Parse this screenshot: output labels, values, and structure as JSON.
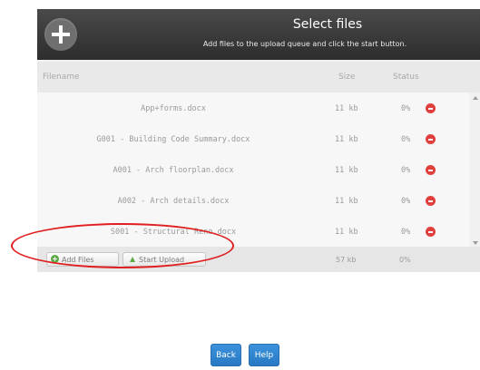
{
  "header": {
    "title": "Select files",
    "subtitle": "Add files to the upload queue and click the start button."
  },
  "columns": {
    "filename": "Filename",
    "size": "Size",
    "status": "Status"
  },
  "files": [
    {
      "name": "App+forms.docx",
      "size": "11 kb",
      "status": "0%"
    },
    {
      "name": "G001 - Building Code Summary.docx",
      "size": "11 kb",
      "status": "0%"
    },
    {
      "name": "A001 - Arch floorplan.docx",
      "size": "11 kb",
      "status": "0%"
    },
    {
      "name": "A002 - Arch details.docx",
      "size": "11 kb",
      "status": "0%"
    },
    {
      "name": "S001 - Structural Reno.docx",
      "size": "11 kb",
      "status": "0%"
    }
  ],
  "footer": {
    "add_files_label": "Add Files",
    "start_upload_label": "Start Upload",
    "total_size": "57 kb",
    "total_status": "0%"
  },
  "nav": {
    "back_label": "Back",
    "help_label": "Help"
  },
  "colors": {
    "header_bg": "#333333",
    "remove_icon": "#e0403c",
    "add_icon": "#5aab45",
    "nav_button": "#2f86d1",
    "highlight": "#e02020"
  },
  "icons": {
    "header_add": "plus-circle-icon",
    "remove": "minus-circle-icon",
    "add_files": "plus-icon",
    "start_upload": "arrow-up-icon"
  }
}
